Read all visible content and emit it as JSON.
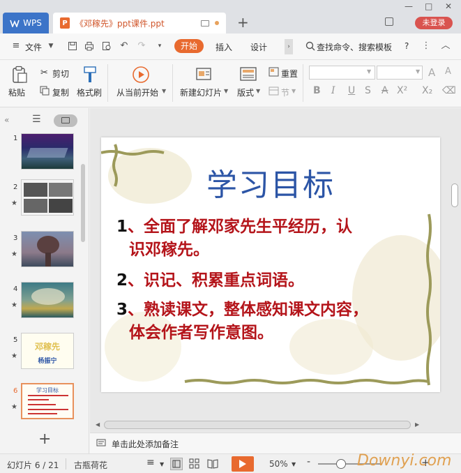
{
  "titlebar": {
    "wps_label": "WPS",
    "doc_tab_title": "《邓稼先》ppt课件.ppt",
    "new_tab": "+",
    "login_label": "未登录",
    "win_min": "—",
    "win_max": "□",
    "win_close": "✕"
  },
  "menubar": {
    "file_label": "文件",
    "start_label": "开始",
    "insert_label": "插入",
    "design_label": "设计",
    "search_label": "查找命令、搜索模板",
    "help_label": "?"
  },
  "ribbon": {
    "paste_label": "粘贴",
    "cut_label": "剪切",
    "copy_label": "复制",
    "format_painter_label": "格式刷",
    "from_current_label": "从当前开始",
    "new_slide_label": "新建幻灯片",
    "layout_label": "版式",
    "reset_label": "重置",
    "section_label": "节"
  },
  "slides_panel": {
    "thumbnails": [
      {
        "num": "1"
      },
      {
        "num": "2"
      },
      {
        "num": "3"
      },
      {
        "num": "4"
      },
      {
        "num": "5"
      },
      {
        "num": "6"
      }
    ],
    "thumb5_title": "邓稼先",
    "thumb5_author": "杨振宁",
    "thumb6_title": "学习目标",
    "add_slide": "+"
  },
  "slide": {
    "title": "学习目标",
    "points": [
      {
        "num": "1",
        "sep": "、",
        "line1": "全面了解邓家先生平经历，认",
        "line2": "识邓稼先。"
      },
      {
        "num": "2",
        "sep": "、",
        "line1": "识记、积累重点词语。"
      },
      {
        "num": "3",
        "sep": "、",
        "line1": "熟读课文，整体感知课文内容，",
        "line2": "体会作者写作意图。"
      }
    ]
  },
  "notes": {
    "placeholder": "单击此处添加备注"
  },
  "statusbar": {
    "slide_counter": "幻灯片 6 / 21",
    "theme_name": "古瓶荷花",
    "zoom_value": "50%",
    "zoom_minus": "-",
    "zoom_plus": "+"
  },
  "watermark": "Downyi.com",
  "colors": {
    "accent": "#e86a2f",
    "title_blue": "#2c55a6",
    "text_red": "#b4141a",
    "wps_blue": "#3c74c8"
  }
}
